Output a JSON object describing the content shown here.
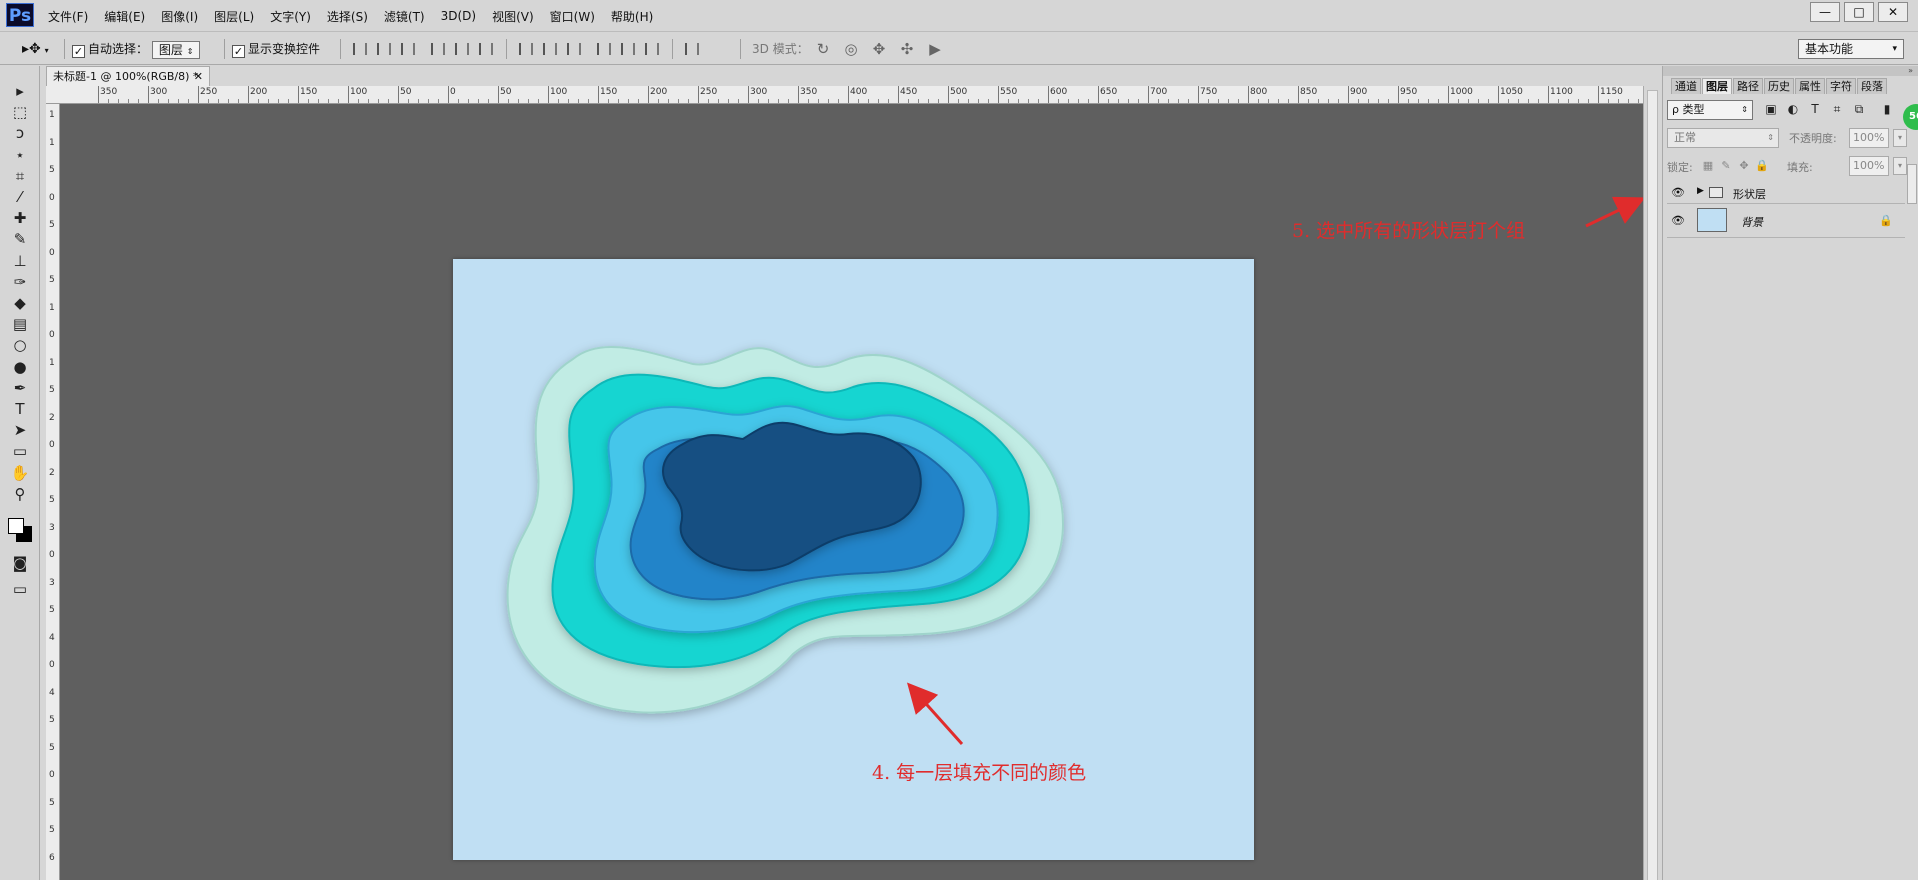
{
  "app": {
    "logo": "Ps"
  },
  "menu": [
    "文件(F)",
    "编辑(E)",
    "图像(I)",
    "图层(L)",
    "文字(Y)",
    "选择(S)",
    "滤镜(T)",
    "3D(D)",
    "视图(V)",
    "窗口(W)",
    "帮助(H)"
  ],
  "window_controls": {
    "minimize": "—",
    "restore": "□",
    "close": "✕"
  },
  "options": {
    "auto_select_label": "自动选择：",
    "auto_select_checked": true,
    "auto_select_target": "图层",
    "show_transform_label": "显示变换控件",
    "show_transform_checked": true,
    "mode_3d_label": "3D 模式：",
    "workspace": "基本功能"
  },
  "document": {
    "tab_title": "未标题-1 @ 100%(RGB/8) *",
    "background_color": "#c0dff3",
    "ruler_top_labels": [
      "350",
      "300",
      "250",
      "200",
      "150",
      "100",
      "50",
      "0",
      "50",
      "100",
      "150",
      "200",
      "250",
      "300",
      "350",
      "400",
      "450",
      "500",
      "550",
      "600",
      "650",
      "700",
      "750",
      "800",
      "850",
      "900",
      "950",
      "1000",
      "1050",
      "1100",
      "1150"
    ],
    "ruler_left_labels": [
      "1",
      "1",
      "5",
      "0",
      "5",
      "0",
      "5",
      "1",
      "0",
      "1",
      "5",
      "2",
      "0",
      "2",
      "5",
      "3",
      "0",
      "3",
      "5",
      "4",
      "0",
      "4",
      "5",
      "5",
      "0",
      "5",
      "5",
      "6"
    ],
    "shapes": [
      {
        "color": "#c1ece4",
        "stroke": "#9fd4cb"
      },
      {
        "color": "#14d5d1",
        "stroke": "#0fb8b8"
      },
      {
        "color": "#45c6ea",
        "stroke": "#2aa5d4"
      },
      {
        "color": "#2484c9",
        "stroke": "#1b6aa8"
      },
      {
        "color": "#124f82",
        "stroke": "#0e3e69"
      }
    ]
  },
  "annotations": {
    "step4": "4. 每一层填充不同的颜色",
    "step5": "5. 选中所有的形状层打个组",
    "color": "#e02c2c"
  },
  "tools": [
    "move-tool",
    "marquee-tool",
    "lasso-tool",
    "quick-select-tool",
    "crop-tool",
    "eyedropper-tool",
    "healing-tool",
    "brush-tool",
    "stamp-tool",
    "history-brush-tool",
    "eraser-tool",
    "gradient-tool",
    "blur-tool",
    "dodge-tool",
    "pen-tool",
    "type-tool",
    "path-select-tool",
    "shape-tool",
    "hand-tool",
    "zoom-tool"
  ],
  "tool_glyphs": [
    "▸",
    "⬚",
    "ↄ",
    "⋆",
    "⌗",
    "⁄",
    "✚",
    "✎",
    "⊥",
    "✑",
    "◆",
    "▤",
    "○",
    "●",
    "✒",
    "T",
    "➤",
    "▭",
    "✋",
    "⚲"
  ],
  "panel": {
    "tabs": [
      "通道",
      "图层",
      "路径",
      "历史",
      "属性",
      "字符",
      "段落"
    ],
    "active_tab": "图层",
    "filter_kind": "ρ 类型",
    "blend_mode": "正常",
    "opacity_label": "不透明度:",
    "opacity_value": "100%",
    "lock_label": "锁定:",
    "fill_label": "填充:",
    "fill_value": "100%",
    "badge": "56",
    "layers": [
      {
        "name": "形状层",
        "type": "group",
        "visible": true
      },
      {
        "name": "背景",
        "type": "background",
        "visible": true,
        "locked": true
      }
    ]
  }
}
